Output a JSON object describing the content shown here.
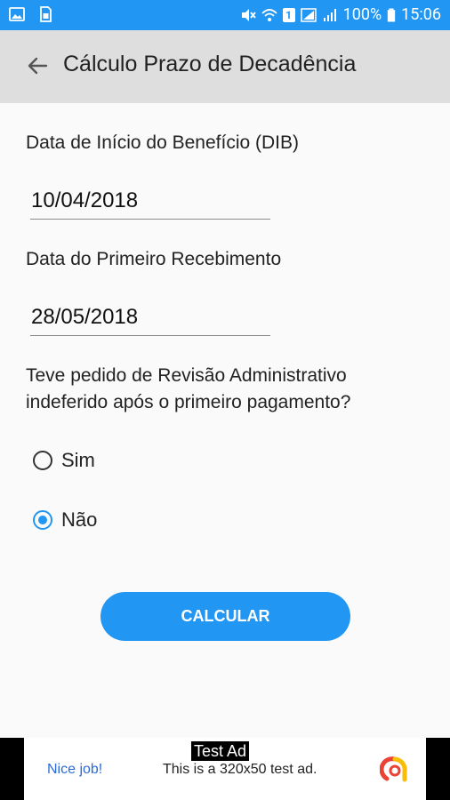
{
  "status_bar": {
    "battery": "100%",
    "time": "15:06",
    "sim": "1"
  },
  "app_bar": {
    "title": "Cálculo Prazo de Decadência"
  },
  "form": {
    "dib_label": "Data de Início do Benefício (DIB)",
    "dib_value": "10/04/2018",
    "first_receipt_label": "Data do Primeiro Recebimento",
    "first_receipt_value": "28/05/2018",
    "question_line1": "Teve pedido de Revisão Administrativo",
    "question_line2": "indeferido após o primeiro pagamento?",
    "option_yes": "Sim",
    "option_no": "Não",
    "selected_option": "Não",
    "calculate_button": "CALCULAR"
  },
  "ad": {
    "tag": "Test Ad",
    "nice_job": "Nice job!",
    "text": "This is a 320x50 test ad."
  },
  "colors": {
    "primary": "#2196f3",
    "app_bar": "#dedede"
  }
}
